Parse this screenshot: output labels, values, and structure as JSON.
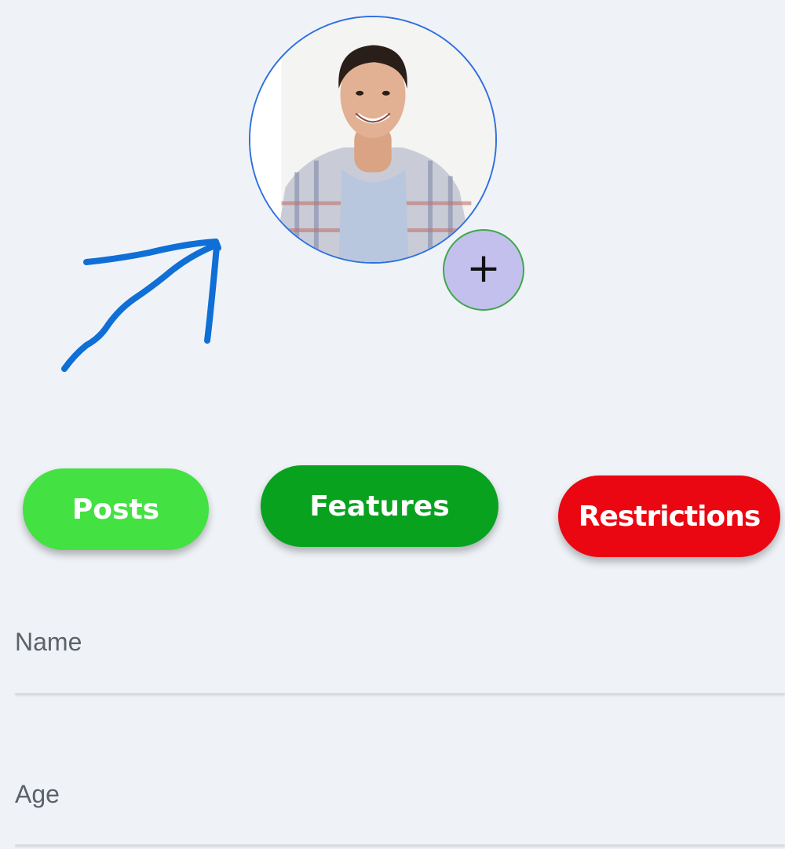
{
  "profile": {
    "avatar_icon": "profile-photo",
    "add_photo_icon": "plus-icon",
    "add_photo_label": "+"
  },
  "tabs": [
    {
      "label": "Posts",
      "color": "#44e142"
    },
    {
      "label": "Features",
      "color": "#08a21f"
    },
    {
      "label": "Restrictions",
      "color": "#ea0711"
    }
  ],
  "form": {
    "name": {
      "label": "Name",
      "value": ""
    },
    "age": {
      "label": "Age",
      "value": ""
    }
  },
  "colors": {
    "background": "#eff3f7",
    "avatar_border": "#2f6fe0",
    "add_button_bg": "#c3c0ee",
    "add_button_border": "#3fa84a",
    "annotation": "#0f6fd6"
  }
}
